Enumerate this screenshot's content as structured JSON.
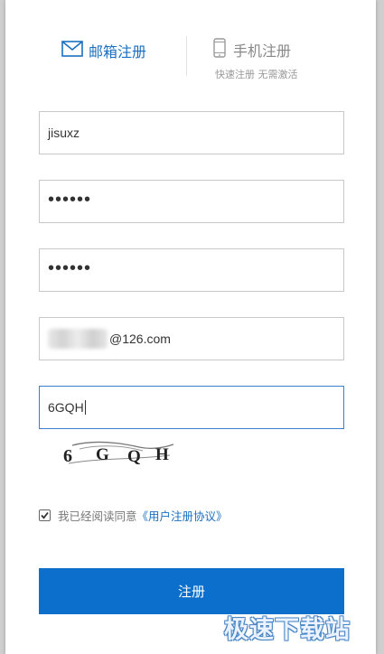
{
  "tabs": {
    "email": {
      "label": "邮箱注册",
      "icon": "envelope-icon",
      "active": true
    },
    "phone": {
      "label": "手机注册",
      "icon": "mobile-phone-icon",
      "subtitle": "快速注册 无需激活"
    }
  },
  "form": {
    "username": {
      "value": "jisuxz"
    },
    "password": {
      "value": "••••••"
    },
    "confirm_password": {
      "value": "••••••"
    },
    "email": {
      "value": "@126.com"
    },
    "captcha_input": {
      "value": "6GQH"
    },
    "captcha_image": {
      "text": "6 G Q H"
    }
  },
  "agreement": {
    "checked": true,
    "prefix": "我已经阅读同意",
    "link": "《用户注册协议》"
  },
  "submit": {
    "label": "注册"
  },
  "watermark": {
    "text": "极速下载站"
  },
  "colors": {
    "accent": "#0b6fcb",
    "link": "#1a6fc0",
    "border": "#c8c8c8",
    "focus_border": "#3b7fd0"
  }
}
